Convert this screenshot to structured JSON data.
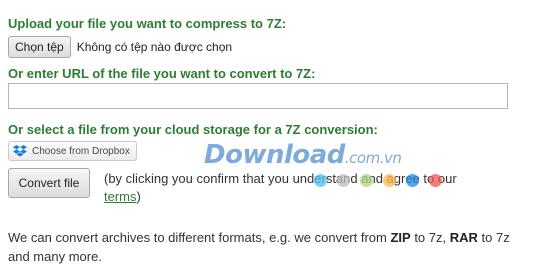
{
  "upload": {
    "heading": "Upload your file you want to compress to 7Z:",
    "choose_label": "Chọn tệp",
    "status": "Không có tệp nào được chọn"
  },
  "url": {
    "heading": "Or enter URL of the file you want to convert to 7Z:",
    "value": "",
    "placeholder": ""
  },
  "cloud": {
    "heading": "Or select a file from your cloud storage for a 7Z conversion:",
    "dropbox_label": "Choose from Dropbox"
  },
  "convert": {
    "button_label": "Convert file",
    "note_before": "(by clicking you confirm that you understand and agree to our ",
    "terms_link": "terms",
    "note_after": ")"
  },
  "info": {
    "part1": "We can convert archives to different formats, e.g. we convert from ",
    "fmt1": "ZIP",
    "part2": " to 7z, ",
    "fmt2": "RAR",
    "part3": " to 7z and many more."
  },
  "watermark": {
    "text": "Download",
    "tld": ".com.vn",
    "dot_colors": [
      "#4fc3f7",
      "#bdbdbd",
      "#aed581",
      "#ffb74d",
      "#1e88e5",
      "#ef5350"
    ]
  },
  "colors": {
    "heading": "#2e7d32",
    "dropbox": "#1081de"
  },
  "icons": {
    "dropbox": "dropbox-icon"
  }
}
